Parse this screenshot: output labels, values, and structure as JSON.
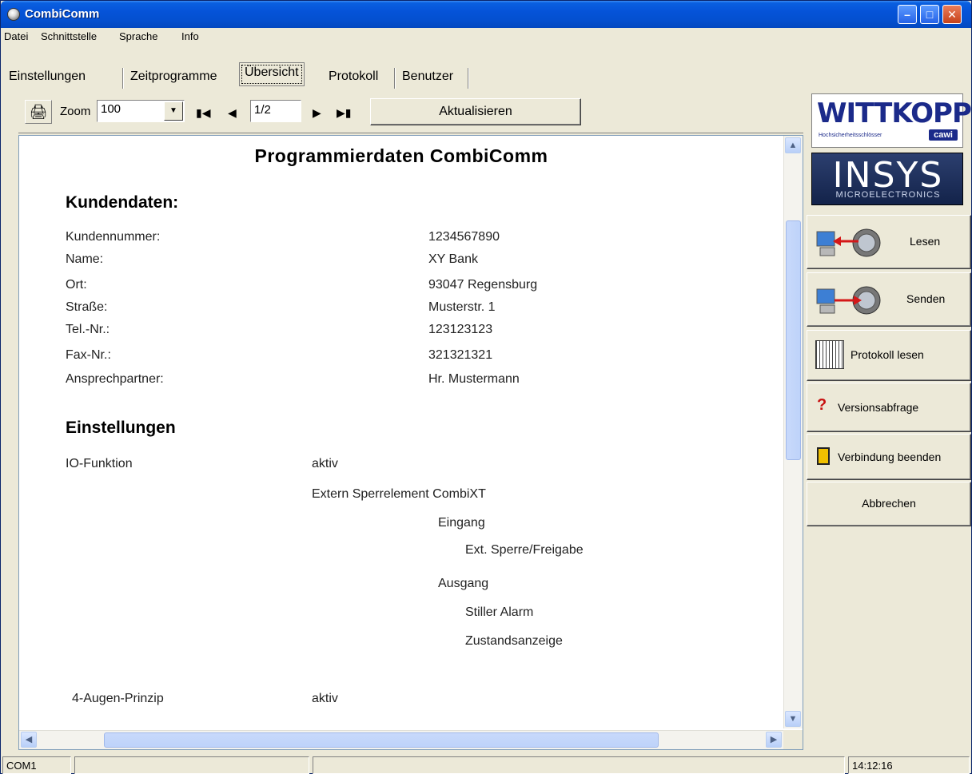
{
  "window": {
    "title": "CombiComm"
  },
  "menu": [
    "Datei",
    "Schnittstelle",
    "Sprache",
    "Info"
  ],
  "tabs": [
    "Einstellungen",
    "Zeitprogramme",
    "Übersicht",
    "Protokoll",
    "Benutzer"
  ],
  "toolbar": {
    "zoom_label": "Zoom",
    "zoom_value": "100",
    "page_value": "1/2",
    "refresh_label": "Aktualisieren"
  },
  "document": {
    "title": "Programmierdaten CombiComm",
    "customer_heading": "Kundendaten:",
    "customer_rows": [
      {
        "label": "Kundennummer:",
        "value": "1234567890"
      },
      {
        "label": "Name:",
        "value": "XY Bank"
      },
      {
        "label": "Ort:",
        "value": "93047 Regensburg"
      },
      {
        "label": "Straße:",
        "value": "Musterstr. 1"
      },
      {
        "label": "Tel.-Nr.:",
        "value": "123123123"
      },
      {
        "label": "Fax-Nr.:",
        "value": "321321321"
      },
      {
        "label": "Ansprechpartner:",
        "value": "Hr. Mustermann"
      }
    ],
    "settings_heading": "Einstellungen",
    "io_label": "IO-Funktion",
    "io_value": "aktiv",
    "io_element": "Extern Sperrelement CombiXT",
    "input_label": "Eingang",
    "input_item": "Ext. Sperre/Freigabe",
    "output_label": "Ausgang",
    "output_items": [
      "Stiller Alarm",
      "Zustandsanzeige"
    ],
    "four_eyes_label": "4-Augen-Prinzip",
    "four_eyes_value": "aktiv"
  },
  "logos": {
    "wittkopp": "WITTKOPP",
    "wittkopp_sub": "Hochsicherheitsschlösser",
    "cawi": "cawi",
    "insys": "INSYS",
    "insys_sub": "MICROELECTRONICS"
  },
  "side_buttons": {
    "read": "Lesen",
    "send": "Senden",
    "read_log": "Protokoll lesen",
    "version": "Versionsabfrage",
    "disconnect": "Verbindung beenden",
    "cancel": "Abbrechen"
  },
  "status": {
    "port": "COM1",
    "time": "14:12:16"
  }
}
